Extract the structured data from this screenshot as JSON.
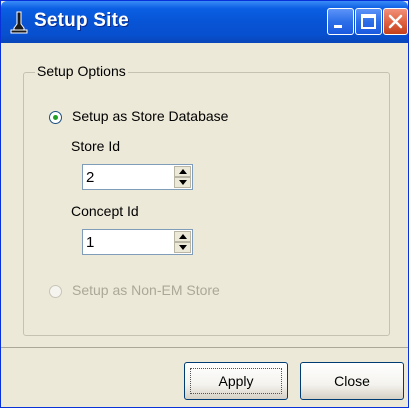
{
  "window": {
    "title": "Setup Site"
  },
  "group": {
    "label": "Setup Options"
  },
  "options": {
    "store_db": {
      "label": "Setup as Store Database",
      "checked": true
    },
    "non_em": {
      "label": "Setup as Non-EM Store",
      "enabled": false
    }
  },
  "fields": {
    "store_id": {
      "label": "Store Id",
      "value": "2"
    },
    "concept_id": {
      "label": "Concept Id",
      "value": "1"
    }
  },
  "buttons": {
    "apply": "Apply",
    "close": "Close"
  },
  "colors": {
    "titlebar": "#0854d6",
    "face": "#ece9d8",
    "radio_dot": "#21a121",
    "disabled_text": "#aca899"
  }
}
